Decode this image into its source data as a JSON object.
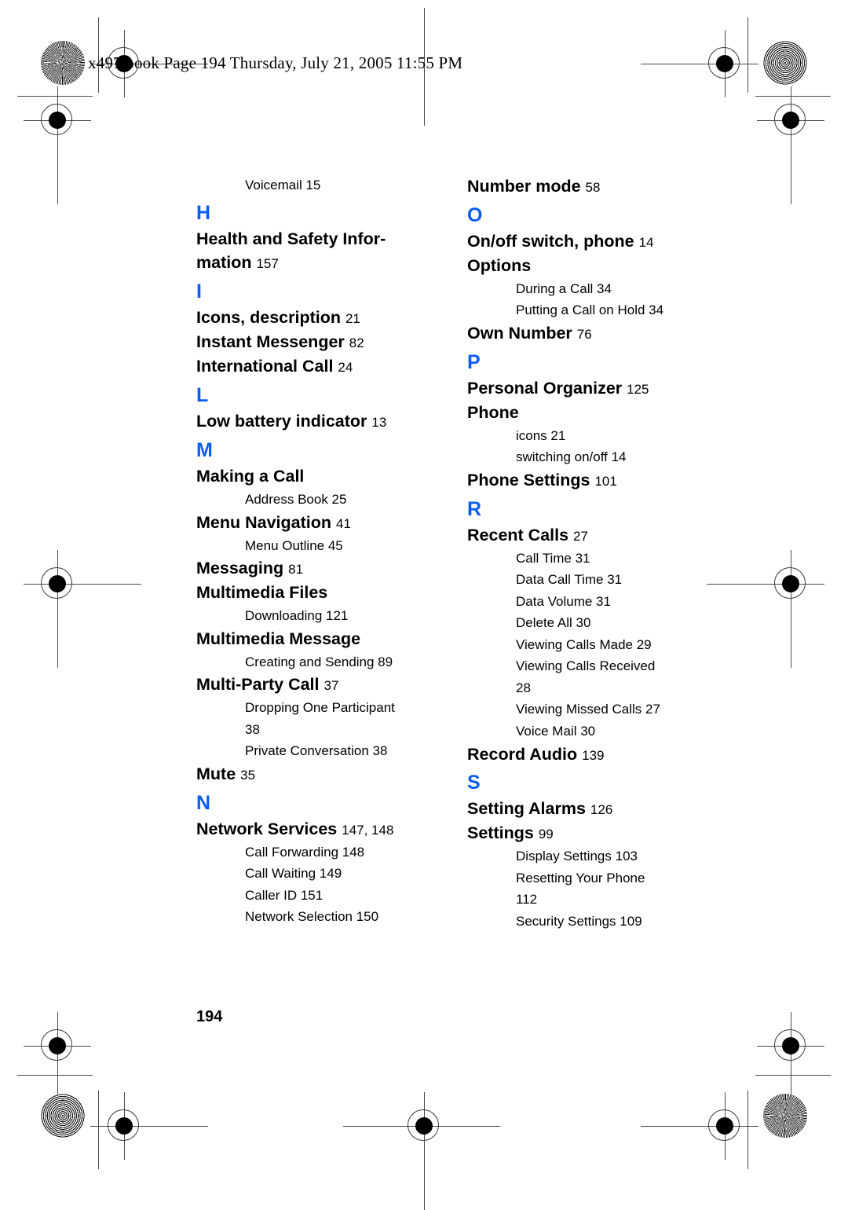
{
  "header": {
    "slug": "x497.book  Page 194  Thursday, July 21, 2005  11:55 PM"
  },
  "footer": {
    "page_number": "194"
  },
  "colors": {
    "letter_heading": "#0a5cf5",
    "text": "#000000",
    "page_background": "#ffffff",
    "registration_mark": "#4a4a4a"
  },
  "columns": [
    {
      "name": "left-column",
      "blocks": [
        {
          "type": "sub",
          "text": "Voicemail  15"
        },
        {
          "type": "letter",
          "text": "H"
        },
        {
          "type": "entry",
          "text": "Health and Safety Infor-"
        },
        {
          "type": "entry",
          "text": "mation",
          "page": "157"
        },
        {
          "type": "letter",
          "text": "I"
        },
        {
          "type": "entry",
          "text": "Icons, description",
          "page": "21"
        },
        {
          "type": "entry",
          "text": "Instant Messenger",
          "page": "82"
        },
        {
          "type": "entry",
          "text": "International Call",
          "page": "24"
        },
        {
          "type": "letter",
          "text": "L"
        },
        {
          "type": "entry",
          "text": "Low battery indicator",
          "page": "13"
        },
        {
          "type": "letter",
          "text": "M"
        },
        {
          "type": "entry",
          "text": "Making a Call"
        },
        {
          "type": "sub",
          "text": "Address Book  25"
        },
        {
          "type": "entry",
          "text": "Menu Navigation",
          "page": "41"
        },
        {
          "type": "sub",
          "text": "Menu Outline  45"
        },
        {
          "type": "entry",
          "text": "Messaging",
          "page": "81"
        },
        {
          "type": "entry",
          "text": "Multimedia Files"
        },
        {
          "type": "sub",
          "text": "Downloading  121"
        },
        {
          "type": "entry",
          "text": "Multimedia Message"
        },
        {
          "type": "sub",
          "text": "Creating and Sending  89"
        },
        {
          "type": "entry",
          "text": "Multi-Party Call",
          "page": "37"
        },
        {
          "type": "sub",
          "text": "Dropping One Participant"
        },
        {
          "type": "sub",
          "text": "38"
        },
        {
          "type": "sub",
          "text": "Private Conversation  38"
        },
        {
          "type": "entry",
          "text": "Mute",
          "page": "35"
        },
        {
          "type": "letter",
          "text": "N"
        },
        {
          "type": "entry",
          "text": "Network Services",
          "page": "147, 148"
        },
        {
          "type": "sub",
          "text": "Call Forwarding  148"
        },
        {
          "type": "sub",
          "text": "Call Waiting  149"
        },
        {
          "type": "sub",
          "text": "Caller ID  151"
        },
        {
          "type": "sub",
          "text": "Network Selection  150"
        }
      ]
    },
    {
      "name": "right-column",
      "blocks": [
        {
          "type": "entry",
          "text": "Number mode",
          "page": "58"
        },
        {
          "type": "letter",
          "text": "O"
        },
        {
          "type": "entry",
          "text": "On/off switch, phone",
          "page": "14"
        },
        {
          "type": "entry",
          "text": "Options"
        },
        {
          "type": "sub",
          "text": "During a Call  34"
        },
        {
          "type": "sub",
          "text": "Putting a Call on Hold  34"
        },
        {
          "type": "entry",
          "text": "Own Number",
          "page": "76"
        },
        {
          "type": "letter",
          "text": "P"
        },
        {
          "type": "entry",
          "text": "Personal Organizer",
          "page": "125"
        },
        {
          "type": "entry",
          "text": "Phone"
        },
        {
          "type": "sub",
          "text": "icons  21"
        },
        {
          "type": "sub",
          "text": "switching on/off  14"
        },
        {
          "type": "entry",
          "text": "Phone Settings",
          "page": "101"
        },
        {
          "type": "letter",
          "text": "R"
        },
        {
          "type": "entry",
          "text": "Recent Calls",
          "page": "27"
        },
        {
          "type": "sub",
          "text": "Call Time  31"
        },
        {
          "type": "sub",
          "text": "Data Call Time  31"
        },
        {
          "type": "sub",
          "text": "Data Volume  31"
        },
        {
          "type": "sub",
          "text": "Delete All  30"
        },
        {
          "type": "sub",
          "text": "Viewing Calls Made  29"
        },
        {
          "type": "sub",
          "text": "Viewing Calls Received"
        },
        {
          "type": "sub",
          "text": "28"
        },
        {
          "type": "sub",
          "text": "Viewing Missed Calls  27"
        },
        {
          "type": "sub",
          "text": "Voice Mail  30"
        },
        {
          "type": "entry",
          "text": "Record Audio",
          "page": "139"
        },
        {
          "type": "letter",
          "text": "S"
        },
        {
          "type": "entry",
          "text": "Setting Alarms",
          "page": "126"
        },
        {
          "type": "entry",
          "text": "Settings",
          "page": "99"
        },
        {
          "type": "sub",
          "text": "Display Settings  103"
        },
        {
          "type": "sub",
          "text": "Resetting Your Phone"
        },
        {
          "type": "sub",
          "text": "112"
        },
        {
          "type": "sub",
          "text": "Security Settings  109"
        }
      ]
    }
  ]
}
